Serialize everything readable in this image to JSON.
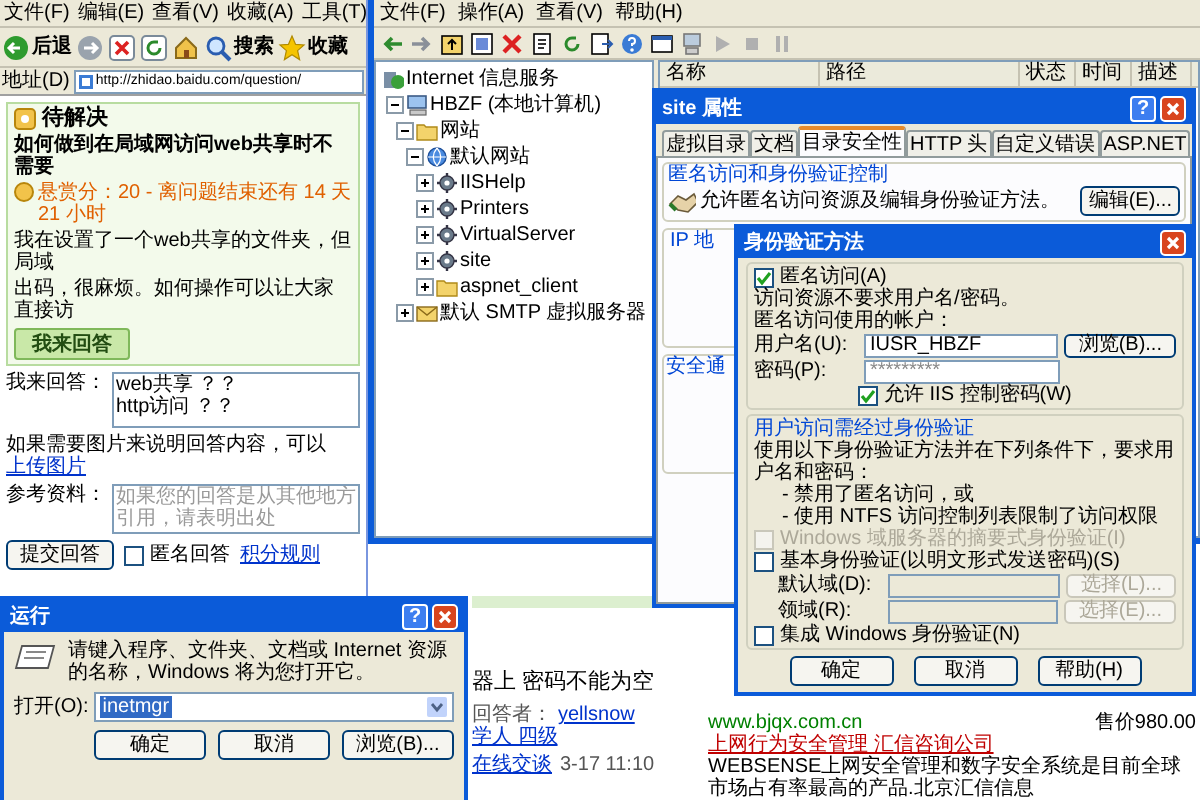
{
  "browser": {
    "menu": [
      "文件(F)",
      "编辑(E)",
      "查看(V)",
      "收藏(A)",
      "工具(T)"
    ],
    "toolbar": [
      {
        "kind": "back",
        "label": "后退"
      },
      {
        "kind": "forward"
      },
      {
        "kind": "stop"
      },
      {
        "kind": "refresh"
      },
      {
        "kind": "home"
      },
      {
        "kind": "search",
        "label": "搜索"
      },
      {
        "kind": "favorites",
        "label": "收藏"
      }
    ],
    "address_label": "地址(D)",
    "address": "http://zhidao.baidu.com/question/",
    "status": "待解决",
    "question_title": "如何做到在局域网访问web共享时不需要",
    "reward": "悬赏分：20 - 离问题结束还有 14 天 21 小时",
    "question_lines": [
      "我在设置了一个web共享的文件夹，但局域",
      "出码，很麻烦。如何操作可以让大家直接访"
    ],
    "answer_button": "我来回答",
    "answer_label": "我来回答：",
    "answer_lines": [
      "web共享 ？？",
      "http访问 ？？"
    ],
    "upload_hint": "如果需要图片来说明回答内容，可以",
    "upload_link": "上传图片",
    "reference_label": "参考资料：",
    "reference_placeholder": "如果您的回答是从其他地方引用，请表明出处",
    "submit_button": "提交回答",
    "anonymous": {
      "label": "匿名回答",
      "checked": false
    },
    "rules_link": "积分规则",
    "answer_excerpt": "器上 密码不能为空",
    "answerer_label": "回答者：",
    "answerer": "yellsnow",
    "answerer_rank": "学人 四级",
    "chat_link": "在线交谈",
    "answer_time": "3-17 11:10",
    "ad": {
      "price": "售价980.00",
      "url": "www.bjqx.com.cn",
      "title": "上网行为安全管理 汇信咨询公司",
      "lines": [
        "WEBSENSE上网安全管理和数字安全系统是目前全球",
        "市场占有率最高的产品.北京汇信信息"
      ]
    }
  },
  "iis": {
    "menu": [
      "文件(F)",
      "操作(A)",
      "查看(V)",
      "帮助(H)"
    ],
    "tree": [
      {
        "label": "Internet 信息服务",
        "kind": "root",
        "children": [
          {
            "label": "HBZF (本地计算机)",
            "kind": "computer",
            "expanded": true,
            "children": [
              {
                "label": "网站",
                "kind": "folder",
                "expanded": true,
                "children": [
                  {
                    "label": "默认网站",
                    "kind": "site",
                    "expanded": true,
                    "children": [
                      {
                        "label": "IISHelp",
                        "kind": "vdir",
                        "expanded": false
                      },
                      {
                        "label": "Printers",
                        "kind": "vdir",
                        "expanded": false
                      },
                      {
                        "label": "VirtualServer",
                        "kind": "vdir",
                        "expanded": false
                      },
                      {
                        "label": "site",
                        "kind": "vdir",
                        "expanded": false
                      },
                      {
                        "label": "aspnet_client",
                        "kind": "folder",
                        "expanded": false
                      }
                    ]
                  }
                ]
              },
              {
                "label": "默认 SMTP 虚拟服务器",
                "kind": "smtp",
                "expanded": false
              }
            ]
          }
        ]
      }
    ],
    "columns": [
      "名称",
      "路径",
      "状态",
      "时间",
      "描述"
    ]
  },
  "properties": {
    "title": "site 属性",
    "help": "?",
    "tabs": [
      {
        "label": "虚拟目录",
        "selected": false
      },
      {
        "label": "文档",
        "selected": false
      },
      {
        "label": "目录安全性",
        "selected": true
      },
      {
        "label": "HTTP 头",
        "selected": false
      },
      {
        "label": "自定义错误",
        "selected": false
      },
      {
        "label": "ASP.NET",
        "selected": false
      }
    ],
    "group_title": "匿名访问和身份验证控制",
    "group_text": "允许匿名访问资源及编辑身份验证方法。",
    "edit_button": "编辑(E)...",
    "ip_group": "IP 地",
    "secure_group": "安全通"
  },
  "auth": {
    "title": "身份验证方法",
    "anonymous": {
      "label": "匿名访问(A)",
      "checked": true
    },
    "anon_note": "访问资源不要求用户名/密码。",
    "account_label": "匿名访问使用的帐户：",
    "user_label": "用户名(U):",
    "user_value": "IUSR_HBZF",
    "browse_button": "浏览(B)...",
    "password_label": "密码(P):",
    "password_value": "*********",
    "iis_password": {
      "label": "允许 IIS 控制密码(W)",
      "checked": true
    },
    "auth_group": "用户访问需经过身份验证",
    "auth_note": "使用以下身份验证方法并在下列条件下，要求用户名和密码：",
    "conditions": [
      "- 禁用了匿名访问，或",
      "- 使用 NTFS 访问控制列表限制了访问权限"
    ],
    "methods": [
      {
        "label": "Windows 域服务器的摘要式身份验证(I)",
        "checked": false,
        "disabled": true
      },
      {
        "label": "基本身份验证(以明文形式发送密码)(S)",
        "checked": false,
        "disabled": false
      }
    ],
    "domain_label": "默认域(D):",
    "domain_button": "选择(L)...",
    "realm_label": "领域(R):",
    "realm_button": "选择(E)...",
    "domain_disabled": true,
    "integrated": {
      "label": "集成 Windows 身份验证(N)",
      "checked": false,
      "disabled": false
    },
    "buttons": [
      "确定",
      "取消",
      "帮助(H)"
    ]
  },
  "run": {
    "title": "运行",
    "help": "?",
    "prompt": "请键入程序、文件夹、文档或 Internet 资源的名称，Windows 将为您打开它。",
    "open_label": "打开(O):",
    "value": "inetmgr",
    "value_selected": true,
    "buttons": [
      "确定",
      "取消",
      "浏览(B)..."
    ]
  }
}
